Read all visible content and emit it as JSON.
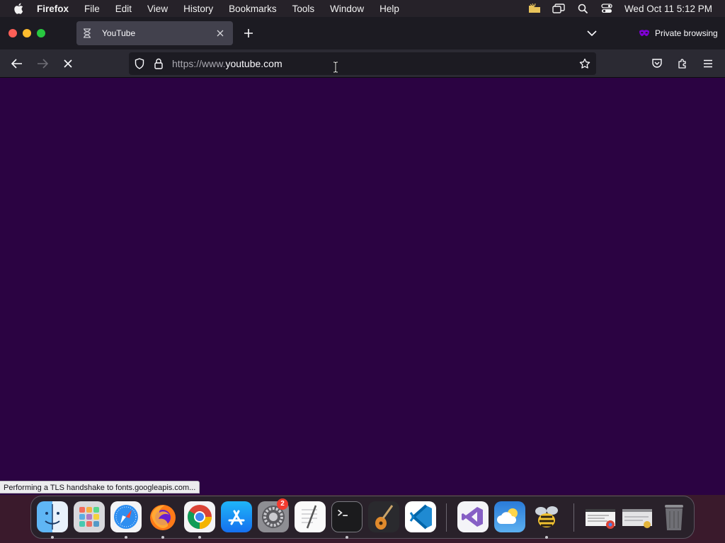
{
  "menubar": {
    "app_name": "Firefox",
    "menus": [
      "File",
      "Edit",
      "View",
      "History",
      "Bookmarks",
      "Tools",
      "Window",
      "Help"
    ],
    "clock": "Wed Oct 11  5:12 PM"
  },
  "tabs": [
    {
      "title": "YouTube",
      "active": true,
      "icon": "hourglass-loading-icon"
    }
  ],
  "private_label": "Private browsing",
  "urlbar": {
    "url_prefix": "https://www.",
    "url_domain": "youtube.com"
  },
  "status": "Performing a TLS handshake to fonts.googleapis.com...",
  "colors": {
    "page_background": "#2b0342",
    "private_accent": "#8000d7",
    "traffic_close": "#fe5f57",
    "traffic_min": "#febc2e",
    "traffic_max": "#28c840"
  },
  "dock": {
    "apps": [
      {
        "name": "Finder",
        "icon": "finder-icon",
        "running": true
      },
      {
        "name": "Launchpad",
        "icon": "launchpad-icon",
        "running": false
      },
      {
        "name": "Safari",
        "icon": "safari-icon",
        "running": true
      },
      {
        "name": "Firefox",
        "icon": "firefox-icon",
        "running": true
      },
      {
        "name": "Google Chrome",
        "icon": "chrome-icon",
        "running": true
      },
      {
        "name": "App Store",
        "icon": "app-store-icon",
        "running": false
      },
      {
        "name": "System Settings",
        "icon": "settings-icon",
        "running": false,
        "badge": "2"
      },
      {
        "name": "TextEdit",
        "icon": "textedit-icon",
        "running": false
      },
      {
        "name": "Terminal",
        "icon": "terminal-icon",
        "running": true
      },
      {
        "name": "GarageBand",
        "icon": "garageband-icon",
        "running": false
      },
      {
        "name": "Visual Studio Code",
        "icon": "vscode-icon",
        "running": false
      },
      {
        "name": "Visual Studio",
        "icon": "visual-studio-icon",
        "running": false
      },
      {
        "name": "Weather",
        "icon": "weather-icon",
        "running": false
      },
      {
        "name": "Cyberduck",
        "icon": "bee-icon",
        "running": true
      },
      {
        "name": "Chrome Window",
        "icon": "chrome-window-thumbnail",
        "running": false
      },
      {
        "name": "Window",
        "icon": "window-thumbnail",
        "running": false
      },
      {
        "name": "Trash",
        "icon": "trash-icon",
        "running": false
      }
    ]
  }
}
